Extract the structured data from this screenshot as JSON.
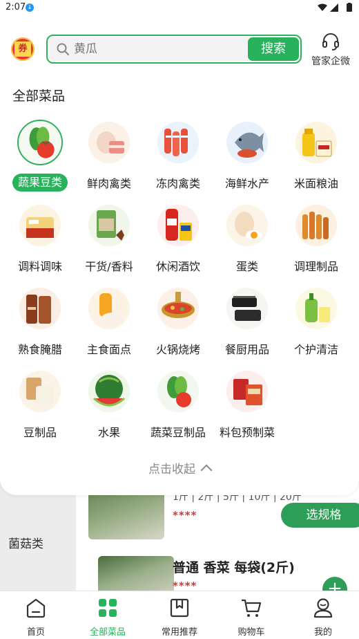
{
  "status_bar": {
    "time": "2:07"
  },
  "search": {
    "placeholder": "黄瓜",
    "button_label": "搜索"
  },
  "steward": {
    "label": "管家企微"
  },
  "coupon": {
    "label": "券"
  },
  "section_title": "全部菜品",
  "categories": [
    {
      "label": "蔬果豆类",
      "active": true
    },
    {
      "label": "鲜肉禽类"
    },
    {
      "label": "冻肉禽类"
    },
    {
      "label": "海鲜水产"
    },
    {
      "label": "米面粮油"
    },
    {
      "label": "调料调味"
    },
    {
      "label": "干货/香料"
    },
    {
      "label": "休闲酒饮"
    },
    {
      "label": "蛋类"
    },
    {
      "label": "调理制品"
    },
    {
      "label": "熟食腌腊"
    },
    {
      "label": "主食面点"
    },
    {
      "label": "火锅烧烤"
    },
    {
      "label": "餐厨用品"
    },
    {
      "label": "个护清洁"
    },
    {
      "label": "豆制品"
    },
    {
      "label": "水果"
    },
    {
      "label": "蔬菜豆制品"
    },
    {
      "label": "料包预制菜"
    }
  ],
  "collapse_label": "点击收起",
  "background": {
    "side_category": "菌菇类",
    "unit_options": "1斤 | 2斤 | 5斤 | 10斤 | 20斤",
    "price_masked_1": "****",
    "spec_button": "选规格",
    "product_title": "普通 香菜 每袋(2斤)",
    "price_masked_2": "****",
    "add_button": "+"
  },
  "bottom_nav": [
    {
      "label": "首页"
    },
    {
      "label": "全部菜品",
      "active": true
    },
    {
      "label": "常用推荐"
    },
    {
      "label": "购物车"
    },
    {
      "label": "我的"
    }
  ],
  "colors": {
    "accent": "#27b25b",
    "accent_border": "#2fb05c",
    "price": "#dd3333"
  }
}
